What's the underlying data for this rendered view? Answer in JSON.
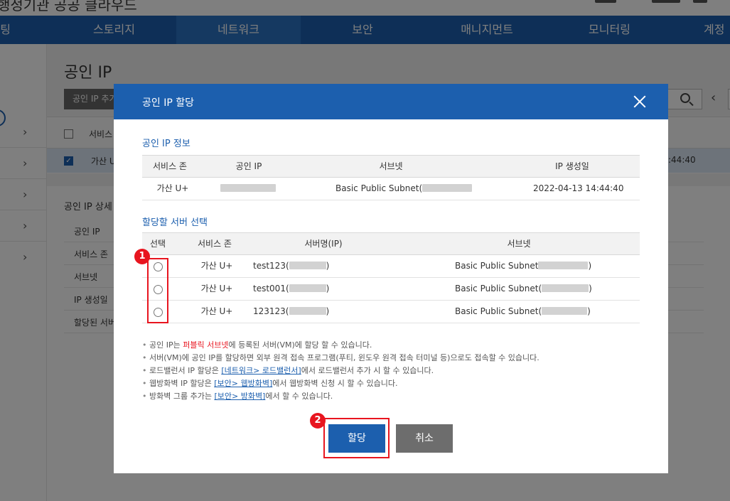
{
  "app": {
    "brand": "행정기관 공공 클라우드"
  },
  "gnb": {
    "items": [
      {
        "label": "컴퓨팅"
      },
      {
        "label": "스토리지"
      },
      {
        "label": "네트워크",
        "active": true
      },
      {
        "label": "보안"
      },
      {
        "label": "매니지먼트"
      },
      {
        "label": "모니터링"
      },
      {
        "label": "계정"
      }
    ]
  },
  "page": {
    "title": "공인 IP",
    "add_button": "공인 IP 추가",
    "list_header_col": "서비스",
    "list_row_zone": "가산 U",
    "list_row_date_tail": ":44:40",
    "detail_title": "공인 IP 상세",
    "detail_rows": [
      "공인 IP",
      "서비스 존",
      "서브넷",
      "IP 생성일",
      "할당된 서버"
    ]
  },
  "modal": {
    "title": "공인 IP 할당",
    "info_section": {
      "title": "공인 IP 정보",
      "headers": [
        "서비스 존",
        "공인 IP",
        "서브넷",
        "IP 생성일"
      ],
      "row": {
        "zone": "가산 U+",
        "ip": "",
        "subnet": "Basic Public Subnet(",
        "created": "2022-04-13 14:44:40"
      }
    },
    "server_section": {
      "title": "할당할 서버 선택",
      "headers": [
        "선택",
        "서비스 존",
        "서버명(IP)",
        "서브넷"
      ],
      "rows": [
        {
          "zone": "가산 U+",
          "name": "test123(",
          "name_end": ")",
          "subnet": "Basic Public Subnet",
          "subnet_end": ")"
        },
        {
          "zone": "가산 U+",
          "name": "test001(",
          "name_end": ")",
          "subnet": "Basic Public Subnet(",
          "subnet_end": ")"
        },
        {
          "zone": "가산 U+",
          "name": "123123(",
          "name_end": ")",
          "subnet": "Basic Public Subnet(",
          "subnet_end": ")"
        }
      ]
    },
    "notes": [
      {
        "pre": "공인 IP는 ",
        "hl": "퍼블릭 서브넷",
        "post": "에 등록된 서버(VM)에 할당 할 수 있습니다."
      },
      {
        "pre": "서버(VM)에 공인 IP를 할당하면 외부 원격 접속 프로그램(푸티, 윈도우 원격 접속 터미널 등)으로도 접속할 수 있습니다."
      },
      {
        "pre": "로드밸런서 IP 할당은 ",
        "link": "[네트워크> 로드밸런서]",
        "post": "에서 로드밸런서 추가 시 할 수 있습니다."
      },
      {
        "pre": "웹방화벽 IP 할당은 ",
        "link": "[보안> 웹방화벽]",
        "post": "에서 웹방화벽 신청 시 할 수 있습니다."
      },
      {
        "pre": "방화벽 그룹 추가는 ",
        "link": "[보안> 방화벽]",
        "post": "에서 할 수 있습니다."
      }
    ],
    "assign_button": "할당",
    "cancel_button": "취소",
    "markers": [
      "1",
      "2"
    ]
  },
  "colors": {
    "primary": "#1c5fae",
    "highlight": "#e8151f",
    "cancel": "#6d6d6d"
  }
}
